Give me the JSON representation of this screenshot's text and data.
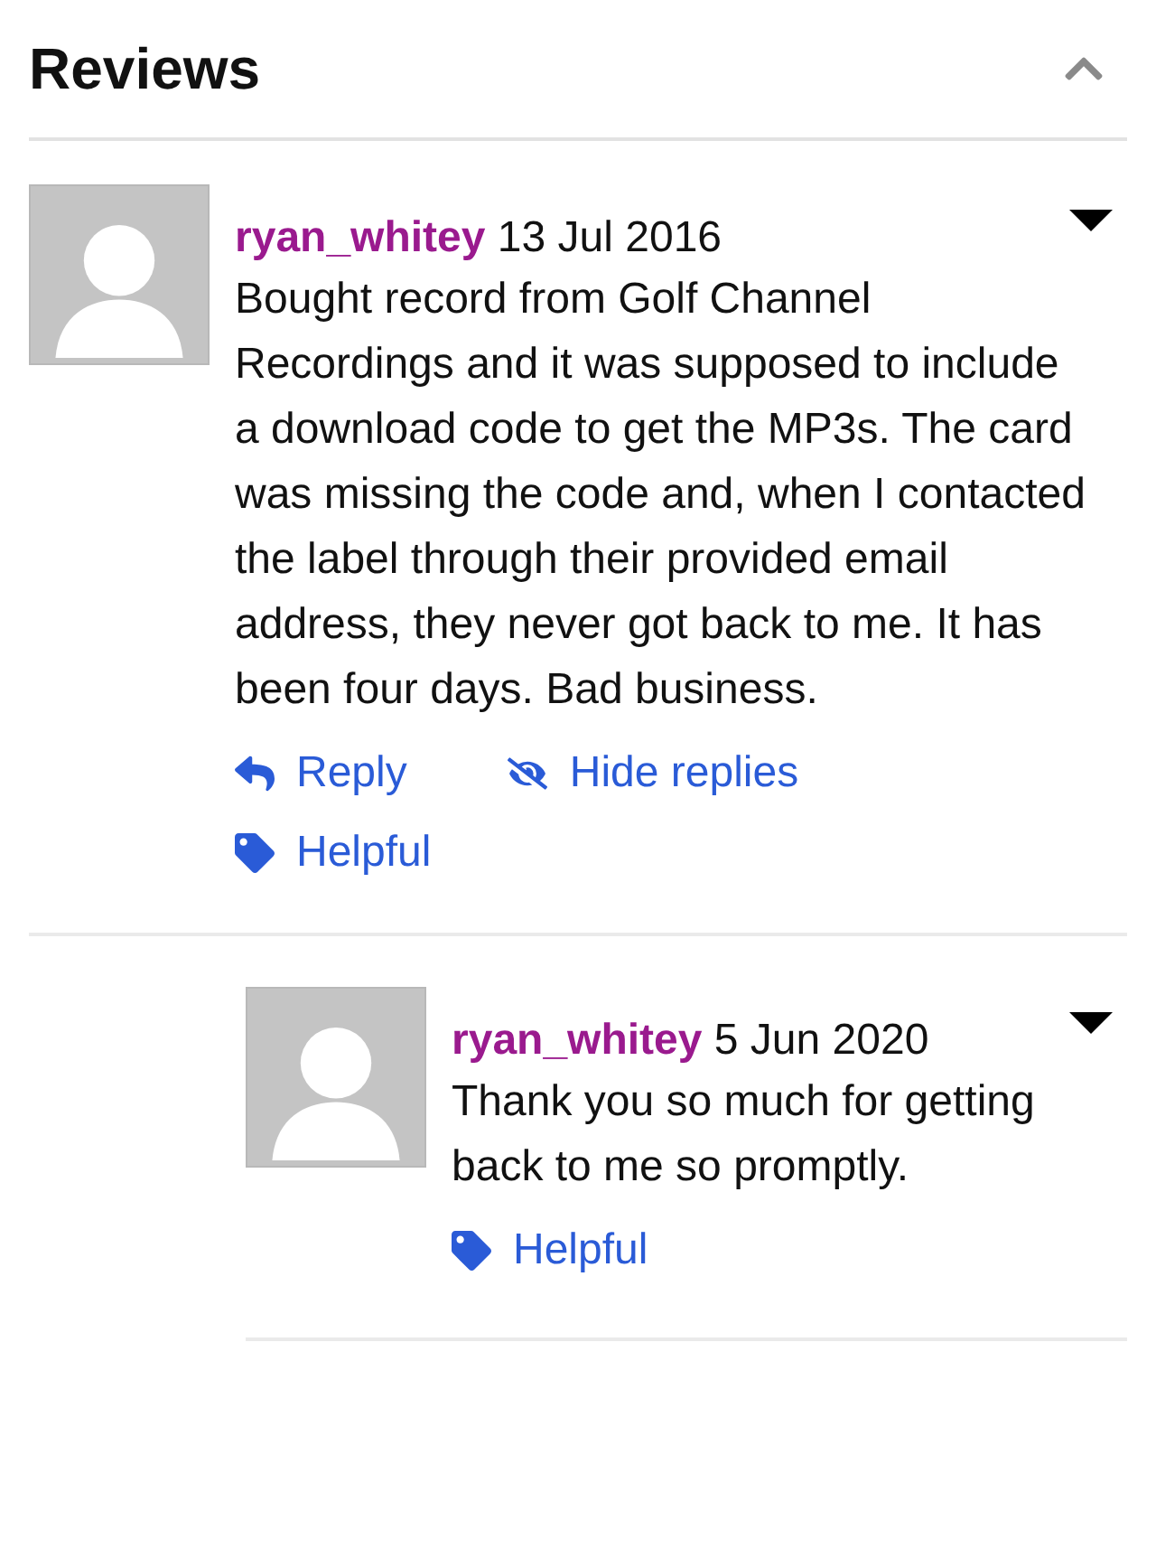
{
  "section": {
    "title": "Reviews",
    "expanded": true
  },
  "comments": [
    {
      "author": "ryan_whitey",
      "date": "13 Jul 2016",
      "text": "Bought record from Golf Channel Recordings and it was supposed to include a download code to get the MP3s. The card was missing the code and, when I contacted the label through their provided email address, they never got back to me. It has been four days. Bad business.",
      "actions": [
        {
          "kind": "reply",
          "label": "Reply"
        },
        {
          "kind": "hide_replies",
          "label": "Hide replies"
        },
        {
          "kind": "helpful",
          "label": "Helpful"
        }
      ],
      "children": [
        {
          "author": "ryan_whitey",
          "date": "5 Jun 2020",
          "text": "Thank you so much for getting back to me so promptly.",
          "actions": [
            {
              "kind": "helpful",
              "label": "Helpful"
            }
          ]
        }
      ]
    }
  ]
}
